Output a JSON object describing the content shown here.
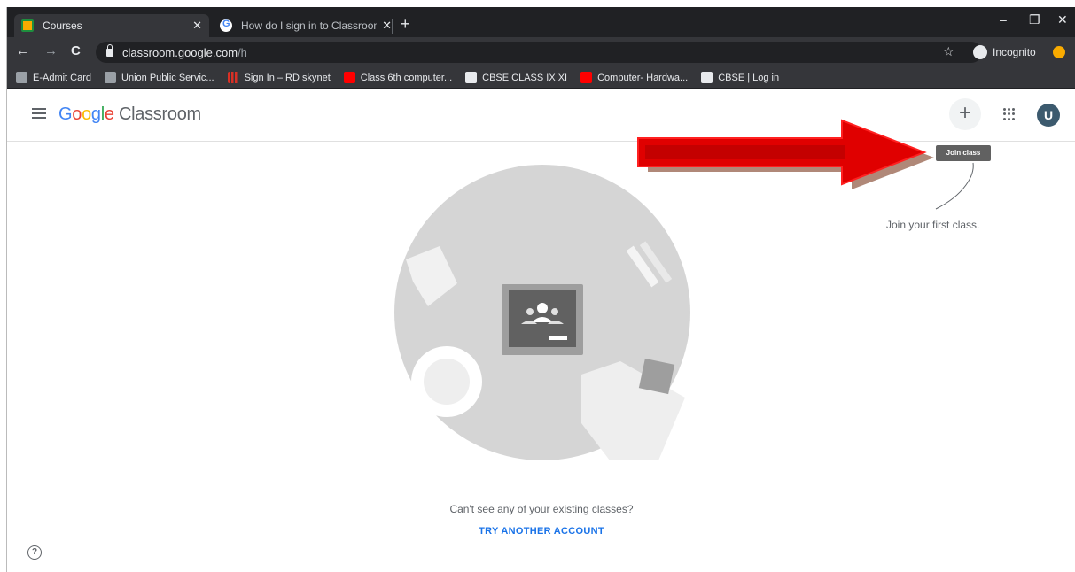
{
  "browser": {
    "tabs": [
      {
        "title": "Courses",
        "active": true
      },
      {
        "title": "How do I sign in to Classroom? -",
        "active": false
      }
    ],
    "new_tab_icon": "plus-icon",
    "url_host": "classroom.google.com",
    "url_path": "/h",
    "incognito_label": "Incognito",
    "bookmarks": [
      {
        "label": "E-Admit Card",
        "icon": "grey"
      },
      {
        "label": "Union Public Servic...",
        "icon": "grey"
      },
      {
        "label": "Sign In – RD skynet",
        "icon": "bars"
      },
      {
        "label": "Class 6th computer...",
        "icon": "youtube"
      },
      {
        "label": "CBSE CLASS IX XI",
        "icon": "globe"
      },
      {
        "label": "Computer- Hardwa...",
        "icon": "youtube"
      },
      {
        "label": "CBSE | Log in",
        "icon": "globe"
      }
    ]
  },
  "app": {
    "logo_google": "Google",
    "logo_product": "Classroom",
    "plus_label": "+",
    "avatar_letter": "U",
    "tooltip": "Join class",
    "hint": "Join your first class.",
    "cant_see": "Can't see any of your existing classes?",
    "try_another": "TRY ANOTHER ACCOUNT",
    "help_symbol": "?"
  },
  "colors": {
    "accent": "#1a73e8",
    "annotation_arrow": "#e00000"
  }
}
